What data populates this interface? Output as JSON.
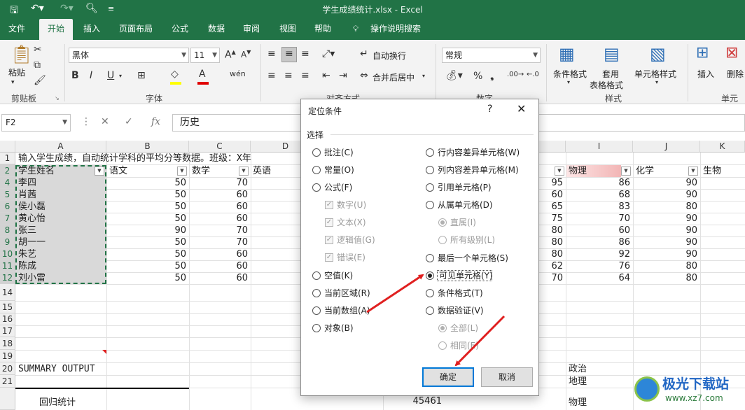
{
  "app": {
    "title": "学生成绩统计.xlsx  -  Excel"
  },
  "tabs": [
    "文件",
    "开始",
    "插入",
    "页面布局",
    "公式",
    "数据",
    "审阅",
    "视图",
    "帮助",
    "操作说明搜索"
  ],
  "ribbon": {
    "clipboard": {
      "paste": "粘贴",
      "group": "剪贴板"
    },
    "font": {
      "name": "黑体",
      "size": "11",
      "group": "字体"
    },
    "align": {
      "wrap": "自动换行",
      "merge": "合并后居中",
      "group": "对齐方式"
    },
    "number": {
      "format": "常规",
      "group": "数字",
      "percent": "%"
    },
    "styles": {
      "cond": "条件格式",
      "table1": "套用",
      "table2": "表格格式",
      "cell": "单元格样式",
      "group": "样式"
    },
    "cells": {
      "insert": "插入",
      "delete": "删除",
      "group": "单元格"
    }
  },
  "formula_bar": {
    "name_box": "F2",
    "content": "历史"
  },
  "columns": [
    "A",
    "B",
    "C",
    "D",
    "I",
    "J",
    "K"
  ],
  "rows": [
    "1",
    "2",
    "4",
    "5",
    "6",
    "7",
    "8",
    "9",
    "10",
    "11",
    "12",
    "14",
    "15",
    "16",
    "17",
    "18",
    "19",
    "20",
    "21",
    ""
  ],
  "sheet": {
    "a1": "输入学生成绩，自动统计学科的平均分等数据。班级：X年",
    "headers": {
      "a": "学生姓名",
      "b": "语文",
      "c": "数学",
      "d": "英语",
      "i": "物理",
      "j": "化学",
      "k": "生物"
    },
    "students": [
      {
        "name": "李四",
        "b": "50",
        "c": "70",
        "h": "95",
        "i": "86",
        "j": "90"
      },
      {
        "name": "肖茜",
        "b": "50",
        "c": "60",
        "h": "60",
        "i": "68",
        "j": "90"
      },
      {
        "name": "侯小磊",
        "b": "50",
        "c": "60",
        "h": "65",
        "i": "83",
        "j": "80"
      },
      {
        "name": "黄心怡",
        "b": "50",
        "c": "60",
        "h": "75",
        "i": "70",
        "j": "90"
      },
      {
        "name": "张三",
        "b": "90",
        "c": "70",
        "h": "80",
        "i": "60",
        "j": "90"
      },
      {
        "name": "胡一一",
        "b": "50",
        "c": "70",
        "h": "80",
        "i": "86",
        "j": "90"
      },
      {
        "name": "朱艺",
        "b": "50",
        "c": "60",
        "h": "80",
        "i": "92",
        "j": "90"
      },
      {
        "name": "陈成",
        "b": "50",
        "c": "60",
        "h": "62",
        "i": "76",
        "j": "80"
      },
      {
        "name": "刘小雷",
        "b": "50",
        "c": "60",
        "h": "70",
        "i": "64",
        "j": "80"
      }
    ],
    "summary": "SUMMARY OUTPUT",
    "reg": "回归统计",
    "val": "45461",
    "i20": "政治",
    "i21": "地理",
    "i_last": "物理"
  },
  "dialog": {
    "title": "定位条件",
    "help": "?",
    "close": "✕",
    "group": "选择",
    "left": [
      "批注(C)",
      "常量(O)",
      "公式(F)"
    ],
    "formula_sub": [
      "数字(U)",
      "文本(X)",
      "逻辑值(G)",
      "错误(E)"
    ],
    "left2": [
      "空值(K)",
      "当前区域(R)",
      "当前数组(A)",
      "对象(B)"
    ],
    "right": [
      "行内容差异单元格(W)",
      "列内容差异单元格(M)",
      "引用单元格(P)",
      "从属单元格(D)"
    ],
    "right_sub": [
      "直属(I)",
      "所有级别(L)"
    ],
    "right2": [
      "最后一个单元格(S)",
      "可见单元格(Y)",
      "条件格式(T)",
      "数据验证(V)"
    ],
    "right2_sub": [
      "全部(L)",
      "相同(E)"
    ],
    "ok": "确定",
    "cancel": "取消"
  },
  "watermark": {
    "text": "极光下载站",
    "url": "www.xz7.com"
  },
  "colors": {
    "excel_green": "#217346",
    "arrow_red": "#e02020",
    "focus_blue": "#0078d7"
  }
}
